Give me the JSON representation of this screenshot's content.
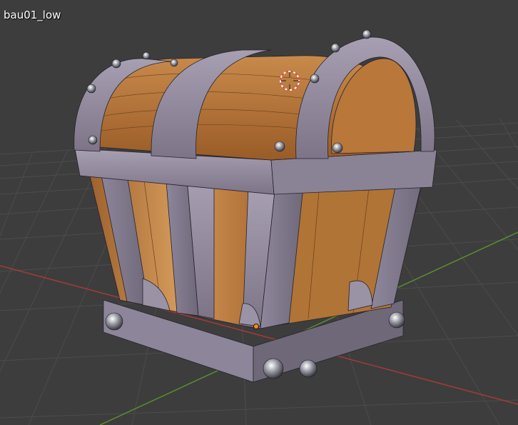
{
  "viewport": {
    "object_name": "bau01_low",
    "background_color": "#3d3d3d",
    "grid_line_color": "#4c4c4c",
    "x_axis_color": "#a53a3a",
    "y_axis_color": "#5a8f2e",
    "object_origin_color": "#f08a24"
  },
  "scene": {
    "model": "treasure-chest",
    "materials": [
      "purple-grey-metal",
      "orange-wood"
    ],
    "wireframe_overlay": true,
    "icons": {
      "cursor": "3d-cursor-icon",
      "origin": "object-origin-icon"
    }
  }
}
